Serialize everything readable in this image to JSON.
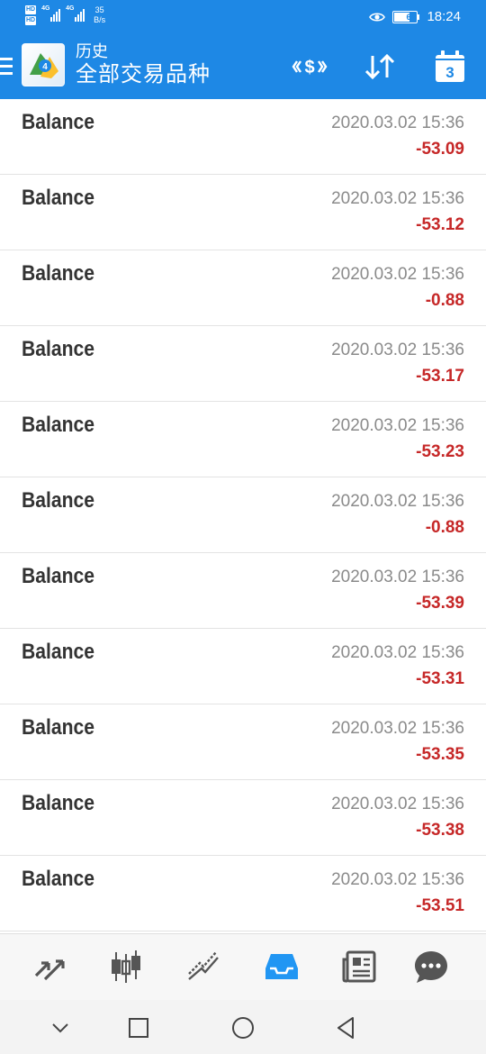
{
  "status_bar": {
    "hd_top": "HD",
    "hd_bottom": "HD",
    "gen_1": "4G",
    "gen_2": "4G",
    "net_speed_value": "35",
    "net_speed_unit": "B/s",
    "battery": "63",
    "time": "18:24"
  },
  "app_bar": {
    "subtitle": "历史",
    "title": "全部交易品种",
    "calendar_day": "3"
  },
  "rows": [
    {
      "label": "Balance",
      "time": "2020.03.02 15:36",
      "amount": "-53.09"
    },
    {
      "label": "Balance",
      "time": "2020.03.02 15:36",
      "amount": "-53.12"
    },
    {
      "label": "Balance",
      "time": "2020.03.02 15:36",
      "amount": "-0.88"
    },
    {
      "label": "Balance",
      "time": "2020.03.02 15:36",
      "amount": "-53.17"
    },
    {
      "label": "Balance",
      "time": "2020.03.02 15:36",
      "amount": "-53.23"
    },
    {
      "label": "Balance",
      "time": "2020.03.02 15:36",
      "amount": "-0.88"
    },
    {
      "label": "Balance",
      "time": "2020.03.02 15:36",
      "amount": "-53.39"
    },
    {
      "label": "Balance",
      "time": "2020.03.02 15:36",
      "amount": "-53.31"
    },
    {
      "label": "Balance",
      "time": "2020.03.02 15:36",
      "amount": "-53.35"
    },
    {
      "label": "Balance",
      "time": "2020.03.02 15:36",
      "amount": "-53.38"
    },
    {
      "label": "Balance",
      "time": "2020.03.02 15:36",
      "amount": "-53.51"
    }
  ],
  "bottom_nav": [
    {
      "icon": "quotes-icon",
      "active": false
    },
    {
      "icon": "chart-icon",
      "active": false
    },
    {
      "icon": "trade-icon",
      "active": false
    },
    {
      "icon": "history-icon",
      "active": true
    },
    {
      "icon": "news-icon",
      "active": false
    },
    {
      "icon": "chat-icon",
      "active": false
    }
  ],
  "colors": {
    "primary": "#1e88e5",
    "negative": "#c62828",
    "nav_icon": "#555555",
    "nav_active": "#2196f3"
  }
}
